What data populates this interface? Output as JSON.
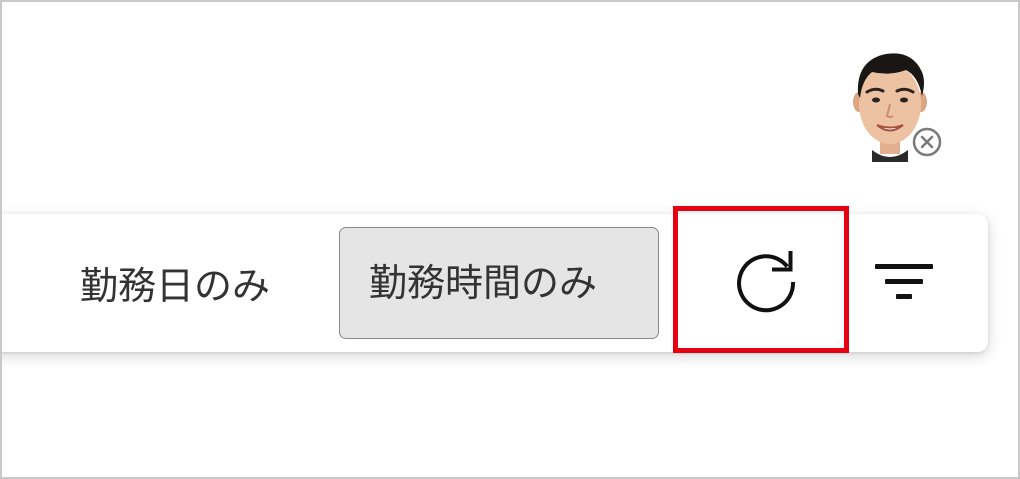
{
  "user": {
    "avatar_icon": "user-photo",
    "remove_icon": "close-circle-icon"
  },
  "toolbar": {
    "options": [
      {
        "label": "勤務日のみ",
        "selected": false
      },
      {
        "label": "勤務時間のみ",
        "selected": true
      }
    ],
    "refresh_icon": "refresh-icon",
    "filter_icon": "filter-icon"
  },
  "colors": {
    "highlight": "#e60012",
    "selected_bg": "#e5e5e5",
    "text": "#333333"
  }
}
